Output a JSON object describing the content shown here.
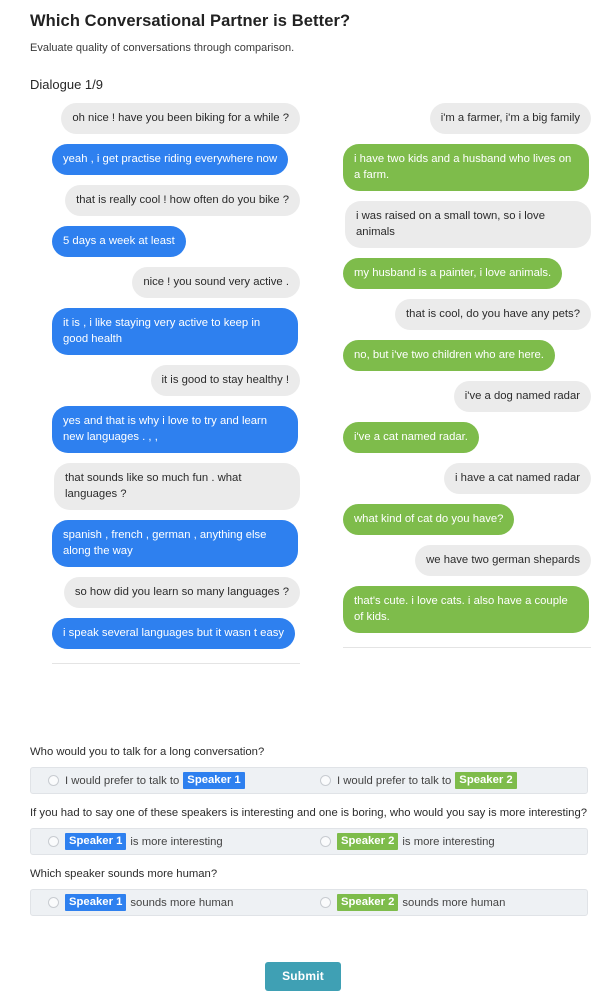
{
  "header": {
    "title": "Which Conversational Partner is Better?",
    "subtitle": "Evaluate quality of conversations through comparison.",
    "dialogue_label": "Dialogue 1/9"
  },
  "colors": {
    "speaker1_blue": "#2e80ef",
    "speaker2_green": "#7ebc4b",
    "them_gray": "#ebebeb",
    "submit_teal": "#3fa0b4",
    "answer_row_bg": "#eef1f4"
  },
  "conversations": [
    {
      "id": "speaker-1-conversation",
      "side": "left",
      "accent": "blue",
      "messages": [
        {
          "speaker": "them",
          "text": "oh nice ! have you been biking for a while ?"
        },
        {
          "speaker": "me",
          "text": "yeah , i get practise riding everywhere now"
        },
        {
          "speaker": "them",
          "text": "that is really cool ! how often do you bike ?"
        },
        {
          "speaker": "me",
          "text": "5 days a week at least"
        },
        {
          "speaker": "them",
          "text": "nice ! you sound very active ."
        },
        {
          "speaker": "me",
          "text": "it is , i like staying very active to keep in good health"
        },
        {
          "speaker": "them",
          "text": "it is good to stay healthy !"
        },
        {
          "speaker": "me",
          "text": "yes and that is why i love to try and learn new languages . , ,"
        },
        {
          "speaker": "them",
          "text": "that sounds like so much fun . what languages ?"
        },
        {
          "speaker": "me",
          "text": "spanish , french , german , anything else along the way"
        },
        {
          "speaker": "them",
          "text": "so how did you learn so many languages ?"
        },
        {
          "speaker": "me",
          "text": "i speak several languages but it wasn t easy"
        }
      ]
    },
    {
      "id": "speaker-2-conversation",
      "side": "right",
      "accent": "green",
      "messages": [
        {
          "speaker": "them",
          "text": "i'm a farmer, i'm a big family"
        },
        {
          "speaker": "me",
          "text": "i have two kids and a husband who lives on a farm."
        },
        {
          "speaker": "them",
          "text": "i was raised on a small town, so i love animals"
        },
        {
          "speaker": "me",
          "text": "my husband is a painter, i love animals."
        },
        {
          "speaker": "them",
          "text": "that is cool, do you have any pets?"
        },
        {
          "speaker": "me",
          "text": "no, but i've two children who are here."
        },
        {
          "speaker": "them",
          "text": "i've a dog named radar"
        },
        {
          "speaker": "me",
          "text": "i've a cat named radar."
        },
        {
          "speaker": "them",
          "text": "i have a cat named radar"
        },
        {
          "speaker": "me",
          "text": "what kind of cat do you have?"
        },
        {
          "speaker": "them",
          "text": "we have two german shepards"
        },
        {
          "speaker": "me",
          "text": "that's cute. i love cats. i also have a couple of kids."
        }
      ]
    }
  ],
  "questions": [
    {
      "id": "q-long-conversation",
      "text": "Who would you to talk for a long conversation?",
      "options": [
        {
          "pre": "I would prefer to talk to",
          "tag": "Speaker 1",
          "tag_color": "blue",
          "post": "",
          "checked": false
        },
        {
          "pre": "I would prefer to talk to",
          "tag": "Speaker 2",
          "tag_color": "green",
          "post": "",
          "checked": false
        }
      ]
    },
    {
      "id": "q-more-interesting",
      "text": "If you had to say one of these speakers is interesting and one is boring, who would you say is more interesting?",
      "options": [
        {
          "pre": "",
          "tag": "Speaker 1",
          "tag_color": "blue",
          "post": "is more interesting",
          "checked": false
        },
        {
          "pre": "",
          "tag": "Speaker 2",
          "tag_color": "green",
          "post": "is more interesting",
          "checked": false
        }
      ]
    },
    {
      "id": "q-more-human",
      "text": "Which speaker sounds more human?",
      "options": [
        {
          "pre": "",
          "tag": "Speaker 1",
          "tag_color": "blue",
          "post": "sounds more human",
          "checked": false
        },
        {
          "pre": "",
          "tag": "Speaker 2",
          "tag_color": "green",
          "post": "sounds more human",
          "checked": false
        }
      ]
    }
  ],
  "submit": {
    "label": "Submit"
  }
}
